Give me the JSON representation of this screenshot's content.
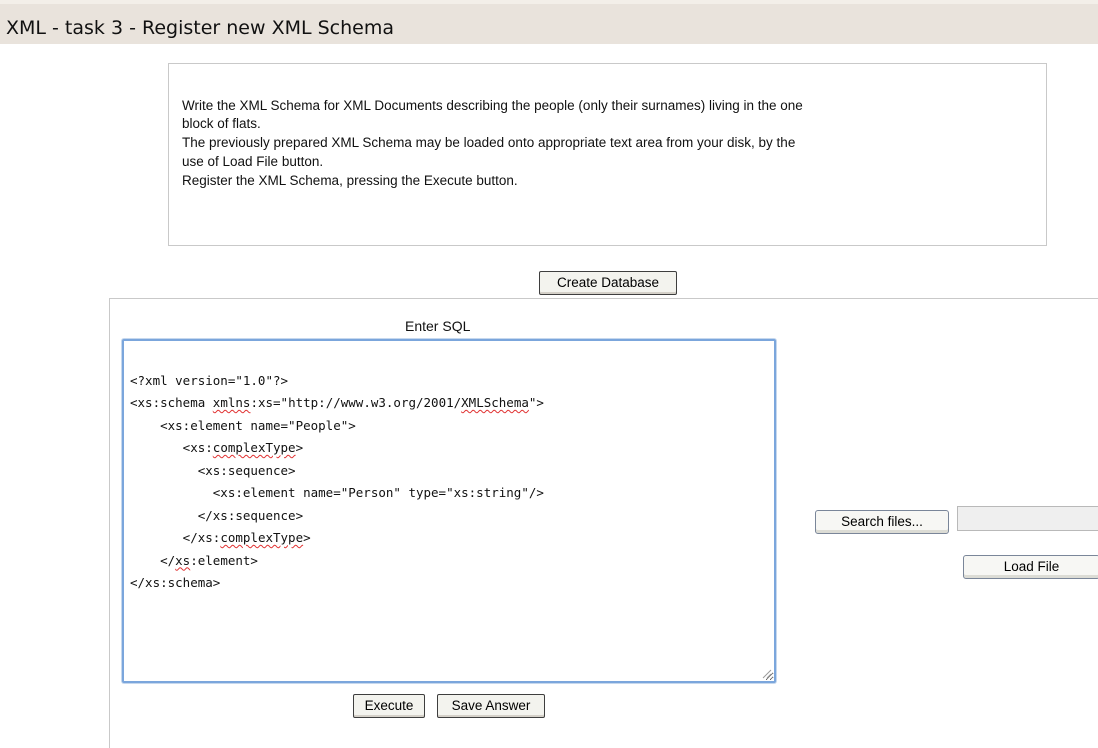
{
  "header": {
    "title": "XML - task 3 - Register new XML Schema"
  },
  "instructions": {
    "lines": [
      "Write the XML Schema for XML Documents describing the people (only their surnames) living in the one",
      "block of flats.",
      "The previously prepared XML Schema may be loaded onto appropriate text area from your disk, by the",
      "use of Load File button.",
      "Register the XML Schema, pressing the Execute button."
    ]
  },
  "buttons": {
    "create_database": "Create Database",
    "search_files": "Search files...",
    "load_file": "Load File",
    "execute": "Execute",
    "save_answer": "Save Answer"
  },
  "editor": {
    "label": "Enter SQL",
    "lines": [
      [
        {
          "t": "<?xml version=\"1.0\"?>"
        }
      ],
      [
        {
          "t": "<xs:schema "
        },
        {
          "t": "xmlns",
          "sp": true
        },
        {
          "t": ":xs=\"http://www.w3.org/2001/"
        },
        {
          "t": "XMLSchema",
          "sp": true
        },
        {
          "t": "\">"
        }
      ],
      [
        {
          "t": "    <xs:element name=\"People\">"
        }
      ],
      [
        {
          "t": "       <xs:"
        },
        {
          "t": "complexType",
          "sp": true
        },
        {
          "t": ">"
        }
      ],
      [
        {
          "t": "         <xs:sequence>"
        }
      ],
      [
        {
          "t": "           <xs:element name=\"Person\" type=\"xs:string\"/>"
        }
      ],
      [
        {
          "t": "         </xs:sequence>"
        }
      ],
      [
        {
          "t": "       </xs:"
        },
        {
          "t": "complexType",
          "sp": true
        },
        {
          "t": ">"
        }
      ],
      [
        {
          "t": "    </"
        },
        {
          "t": "xs",
          "sp": true
        },
        {
          "t": ":element>"
        }
      ],
      [
        {
          "t": "</xs:schema>"
        }
      ]
    ]
  },
  "file_input": {
    "value": ""
  },
  "colors": {
    "header_bg": "#e9e3dc",
    "editor_focus_border": "#7ba6dc",
    "spellcheck_underline": "#e03030"
  }
}
